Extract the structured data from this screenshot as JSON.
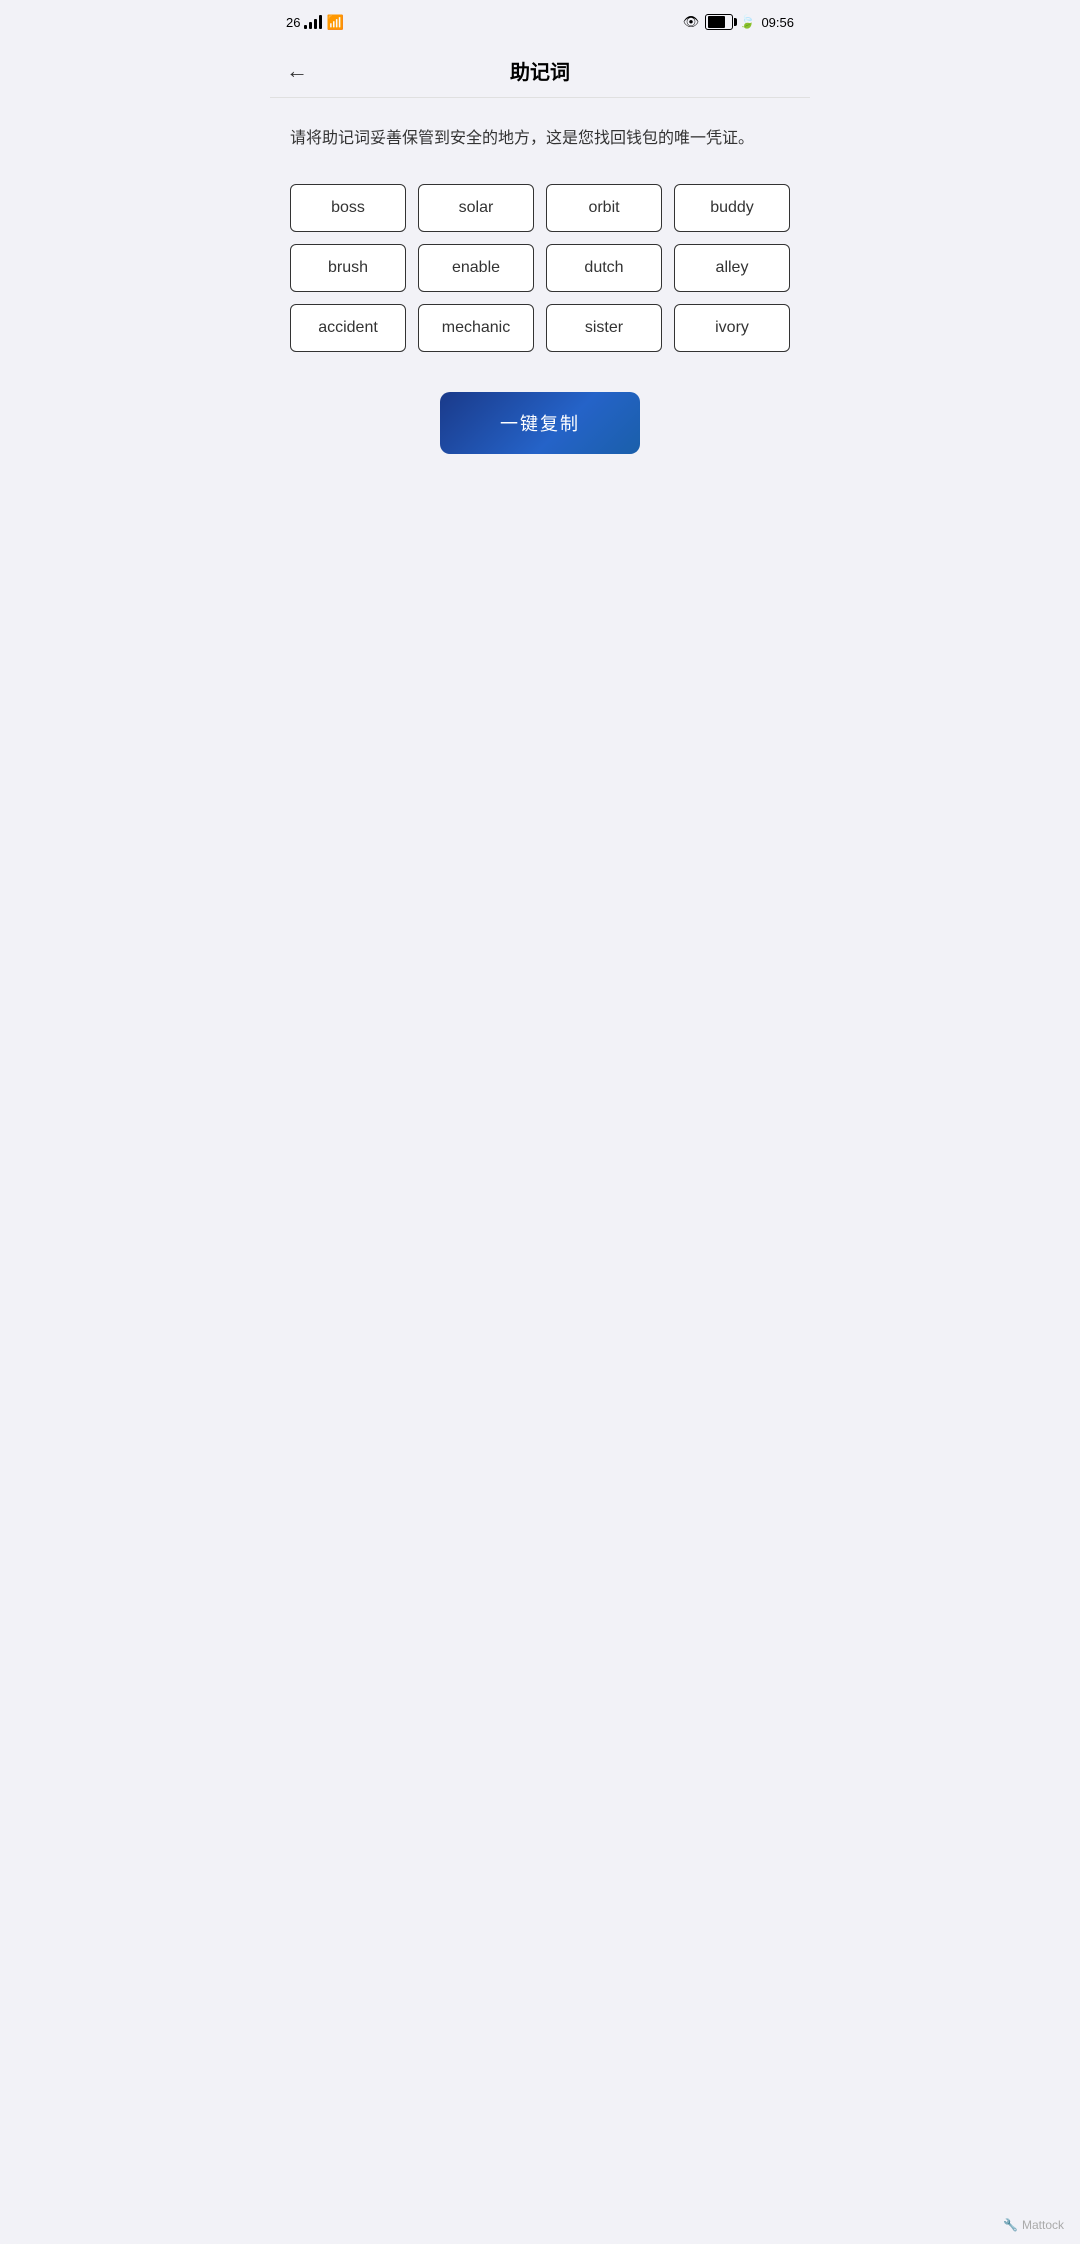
{
  "statusBar": {
    "signal": "26",
    "time": "09:56",
    "battery": "76"
  },
  "navBar": {
    "backIcon": "←",
    "title": "助记词"
  },
  "description": "请将助记词妥善保管到安全的地方，这是您找回钱包的唯一凭证。",
  "mnemonicWords": [
    "boss",
    "solar",
    "orbit",
    "buddy",
    "brush",
    "enable",
    "dutch",
    "alley",
    "accident",
    "mechanic",
    "sister",
    "ivory"
  ],
  "copyButton": {
    "label": "一键复制"
  },
  "footer": {
    "watermark": "Mattock"
  }
}
